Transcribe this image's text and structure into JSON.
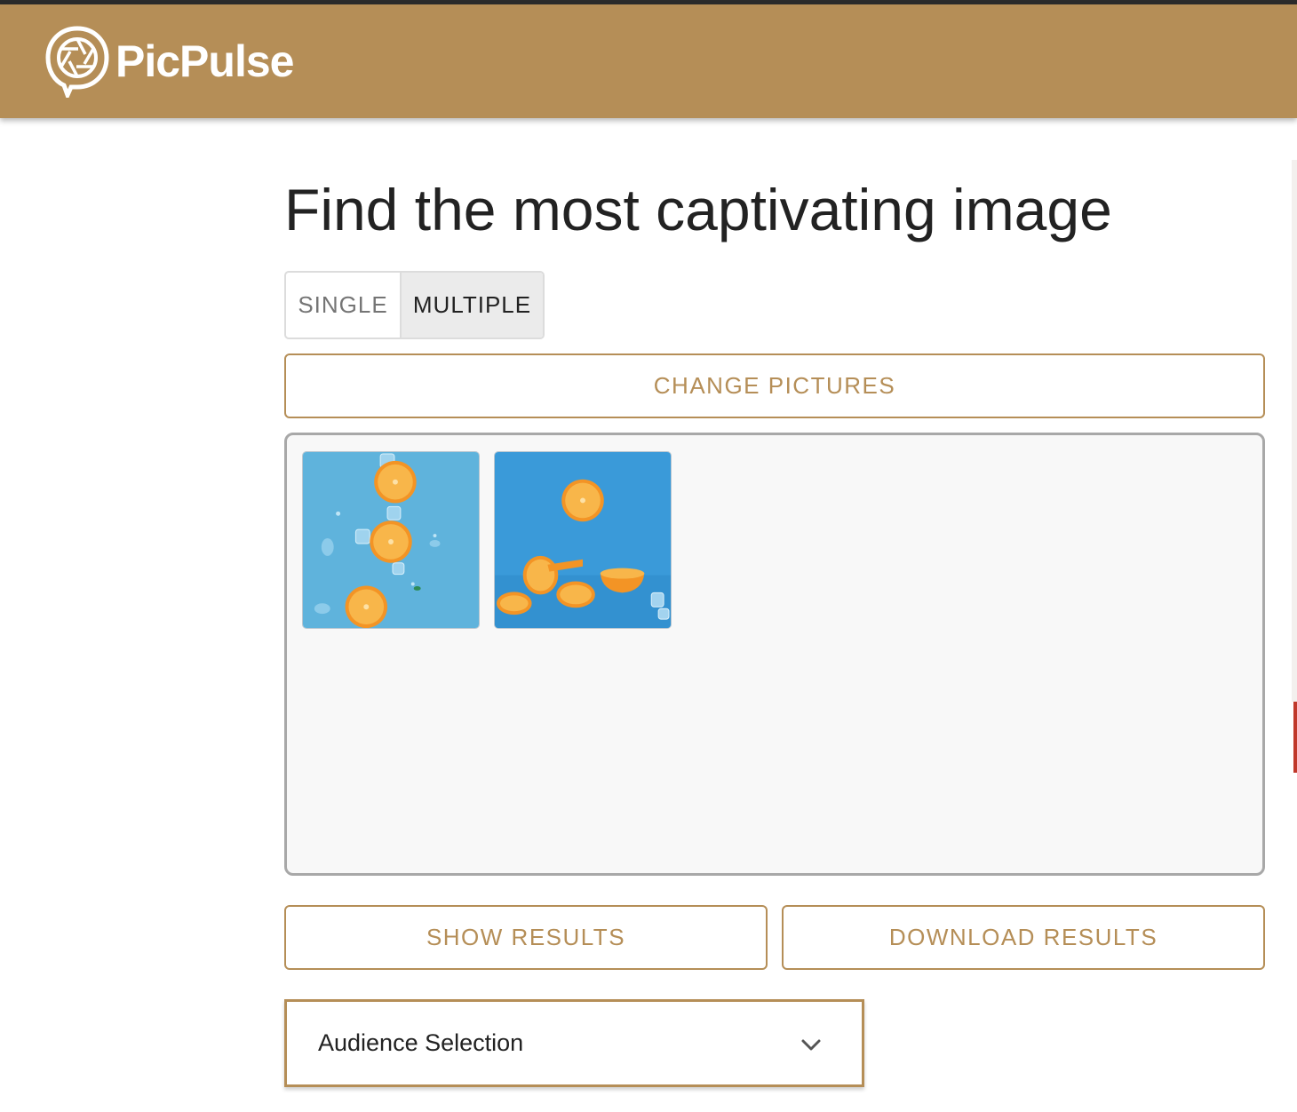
{
  "app": {
    "brand_name": "PicPulse",
    "brand_color": "#b58e57",
    "logo_icon": "camera-shutter-speech-bubble-icon"
  },
  "page": {
    "title": "Find the most captivating image"
  },
  "mode_toggle": {
    "options": [
      {
        "label": "SINGLE",
        "selected": false
      },
      {
        "label": "MULTIPLE",
        "selected": true
      }
    ]
  },
  "actions": {
    "change_pictures": "CHANGE PICTURES",
    "show_results": "SHOW RESULTS",
    "download_results": "DOWNLOAD RESULTS"
  },
  "images": [
    {
      "subject": "orange slices with ice cubes on blue background"
    },
    {
      "subject": "orange halves falling on blue background"
    }
  ],
  "audience": {
    "label": "Audience Selection",
    "icon": "chevron-down-icon"
  }
}
